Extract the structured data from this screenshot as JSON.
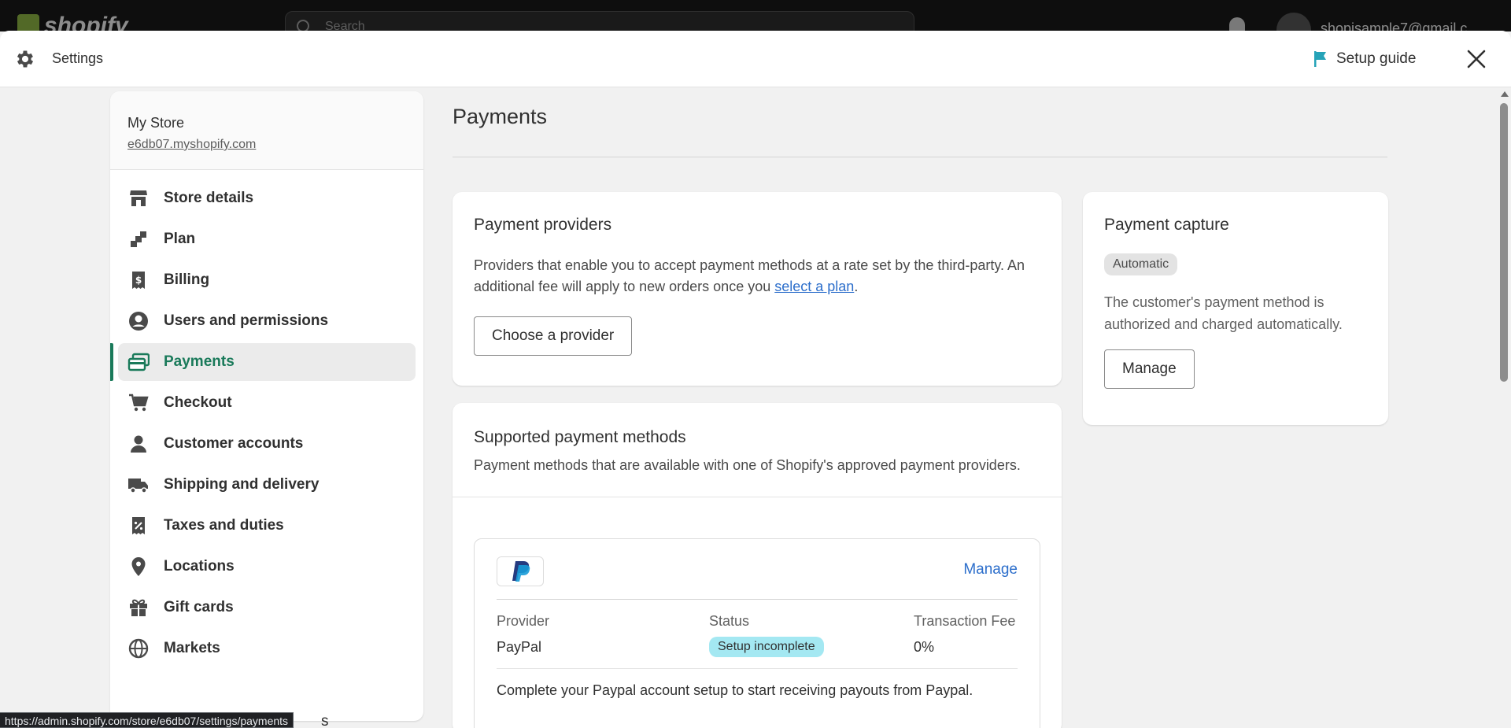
{
  "background": {
    "logo_text": "shopify",
    "search_placeholder": "Search",
    "user_email": "shopisample7@gmail.c"
  },
  "header": {
    "title": "Settings",
    "setup_guide_label": "Setup guide",
    "colors": {
      "flag": "#26a3b8"
    }
  },
  "sidebar": {
    "store_name": "My Store",
    "store_url": "e6db07.myshopify.com",
    "items": [
      {
        "label": "Store details",
        "icon": "store-icon"
      },
      {
        "label": "Plan",
        "icon": "plan-icon"
      },
      {
        "label": "Billing",
        "icon": "billing-icon"
      },
      {
        "label": "Users and permissions",
        "icon": "user-circle-icon"
      },
      {
        "label": "Payments",
        "icon": "payments-icon",
        "active": true
      },
      {
        "label": "Checkout",
        "icon": "cart-icon"
      },
      {
        "label": "Customer accounts",
        "icon": "person-icon"
      },
      {
        "label": "Shipping and delivery",
        "icon": "truck-icon"
      },
      {
        "label": "Taxes and duties",
        "icon": "tax-icon"
      },
      {
        "label": "Locations",
        "icon": "location-pin-icon"
      },
      {
        "label": "Gift cards",
        "icon": "gift-icon"
      },
      {
        "label": "Markets",
        "icon": "globe-icon"
      }
    ],
    "peek_text": "s"
  },
  "main": {
    "page_title": "Payments",
    "providers": {
      "title": "Payment providers",
      "desc_before": "Providers that enable you to accept payment methods at a rate set by the third-party. An additional fee will apply to new orders once you ",
      "desc_link": "select a plan",
      "desc_after": ".",
      "button": "Choose a provider"
    },
    "capture": {
      "title": "Payment capture",
      "badge": "Automatic",
      "desc": "The customer's payment method is authorized and charged automatically.",
      "button": "Manage"
    },
    "methods": {
      "title": "Supported payment methods",
      "desc": "Payment methods that are available with one of Shopify's approved payment providers.",
      "paypal": {
        "manage_label": "Manage",
        "col_provider": "Provider",
        "col_status": "Status",
        "col_fee": "Transaction Fee",
        "provider": "PayPal",
        "status": "Setup incomplete",
        "fee": "0%",
        "note": "Complete your Paypal account setup to start receiving payouts from Paypal."
      }
    }
  },
  "status_url": "https://admin.shopify.com/store/e6db07/settings/payments"
}
